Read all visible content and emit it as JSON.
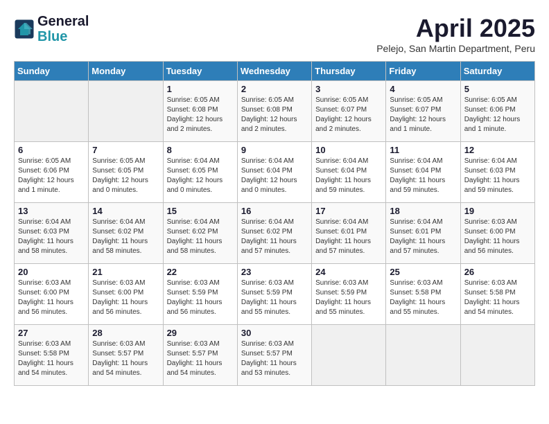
{
  "header": {
    "logo_line1": "General",
    "logo_line2": "Blue",
    "month_title": "April 2025",
    "subtitle": "Pelejo, San Martin Department, Peru"
  },
  "weekdays": [
    "Sunday",
    "Monday",
    "Tuesday",
    "Wednesday",
    "Thursday",
    "Friday",
    "Saturday"
  ],
  "weeks": [
    [
      {
        "day": "",
        "info": ""
      },
      {
        "day": "",
        "info": ""
      },
      {
        "day": "1",
        "info": "Sunrise: 6:05 AM\nSunset: 6:08 PM\nDaylight: 12 hours and 2 minutes."
      },
      {
        "day": "2",
        "info": "Sunrise: 6:05 AM\nSunset: 6:08 PM\nDaylight: 12 hours and 2 minutes."
      },
      {
        "day": "3",
        "info": "Sunrise: 6:05 AM\nSunset: 6:07 PM\nDaylight: 12 hours and 2 minutes."
      },
      {
        "day": "4",
        "info": "Sunrise: 6:05 AM\nSunset: 6:07 PM\nDaylight: 12 hours and 1 minute."
      },
      {
        "day": "5",
        "info": "Sunrise: 6:05 AM\nSunset: 6:06 PM\nDaylight: 12 hours and 1 minute."
      }
    ],
    [
      {
        "day": "6",
        "info": "Sunrise: 6:05 AM\nSunset: 6:06 PM\nDaylight: 12 hours and 1 minute."
      },
      {
        "day": "7",
        "info": "Sunrise: 6:05 AM\nSunset: 6:05 PM\nDaylight: 12 hours and 0 minutes."
      },
      {
        "day": "8",
        "info": "Sunrise: 6:04 AM\nSunset: 6:05 PM\nDaylight: 12 hours and 0 minutes."
      },
      {
        "day": "9",
        "info": "Sunrise: 6:04 AM\nSunset: 6:04 PM\nDaylight: 12 hours and 0 minutes."
      },
      {
        "day": "10",
        "info": "Sunrise: 6:04 AM\nSunset: 6:04 PM\nDaylight: 11 hours and 59 minutes."
      },
      {
        "day": "11",
        "info": "Sunrise: 6:04 AM\nSunset: 6:04 PM\nDaylight: 11 hours and 59 minutes."
      },
      {
        "day": "12",
        "info": "Sunrise: 6:04 AM\nSunset: 6:03 PM\nDaylight: 11 hours and 59 minutes."
      }
    ],
    [
      {
        "day": "13",
        "info": "Sunrise: 6:04 AM\nSunset: 6:03 PM\nDaylight: 11 hours and 58 minutes."
      },
      {
        "day": "14",
        "info": "Sunrise: 6:04 AM\nSunset: 6:02 PM\nDaylight: 11 hours and 58 minutes."
      },
      {
        "day": "15",
        "info": "Sunrise: 6:04 AM\nSunset: 6:02 PM\nDaylight: 11 hours and 58 minutes."
      },
      {
        "day": "16",
        "info": "Sunrise: 6:04 AM\nSunset: 6:02 PM\nDaylight: 11 hours and 57 minutes."
      },
      {
        "day": "17",
        "info": "Sunrise: 6:04 AM\nSunset: 6:01 PM\nDaylight: 11 hours and 57 minutes."
      },
      {
        "day": "18",
        "info": "Sunrise: 6:04 AM\nSunset: 6:01 PM\nDaylight: 11 hours and 57 minutes."
      },
      {
        "day": "19",
        "info": "Sunrise: 6:03 AM\nSunset: 6:00 PM\nDaylight: 11 hours and 56 minutes."
      }
    ],
    [
      {
        "day": "20",
        "info": "Sunrise: 6:03 AM\nSunset: 6:00 PM\nDaylight: 11 hours and 56 minutes."
      },
      {
        "day": "21",
        "info": "Sunrise: 6:03 AM\nSunset: 6:00 PM\nDaylight: 11 hours and 56 minutes."
      },
      {
        "day": "22",
        "info": "Sunrise: 6:03 AM\nSunset: 5:59 PM\nDaylight: 11 hours and 56 minutes."
      },
      {
        "day": "23",
        "info": "Sunrise: 6:03 AM\nSunset: 5:59 PM\nDaylight: 11 hours and 55 minutes."
      },
      {
        "day": "24",
        "info": "Sunrise: 6:03 AM\nSunset: 5:59 PM\nDaylight: 11 hours and 55 minutes."
      },
      {
        "day": "25",
        "info": "Sunrise: 6:03 AM\nSunset: 5:58 PM\nDaylight: 11 hours and 55 minutes."
      },
      {
        "day": "26",
        "info": "Sunrise: 6:03 AM\nSunset: 5:58 PM\nDaylight: 11 hours and 54 minutes."
      }
    ],
    [
      {
        "day": "27",
        "info": "Sunrise: 6:03 AM\nSunset: 5:58 PM\nDaylight: 11 hours and 54 minutes."
      },
      {
        "day": "28",
        "info": "Sunrise: 6:03 AM\nSunset: 5:57 PM\nDaylight: 11 hours and 54 minutes."
      },
      {
        "day": "29",
        "info": "Sunrise: 6:03 AM\nSunset: 5:57 PM\nDaylight: 11 hours and 54 minutes."
      },
      {
        "day": "30",
        "info": "Sunrise: 6:03 AM\nSunset: 5:57 PM\nDaylight: 11 hours and 53 minutes."
      },
      {
        "day": "",
        "info": ""
      },
      {
        "day": "",
        "info": ""
      },
      {
        "day": "",
        "info": ""
      }
    ]
  ]
}
